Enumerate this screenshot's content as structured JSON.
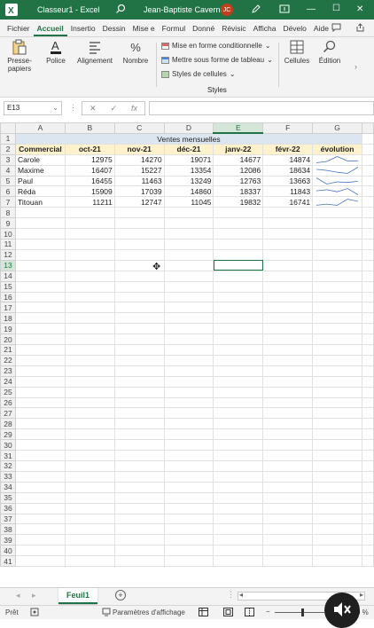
{
  "titlebar": {
    "filename": "Classeur1 - Excel",
    "user": "Jean-Baptiste Caverne",
    "initials": "JC",
    "minimize": "—",
    "maximize": "☐",
    "close": "✕"
  },
  "tabs": [
    "Fichier",
    "Accueil",
    "Insertio",
    "Dessin",
    "Mise e",
    "Formul",
    "Donné",
    "Révisic",
    "Afficha",
    "Dévelo",
    "Aide"
  ],
  "ribbon": {
    "paste_label": "Presse-\npapiers",
    "police_label": "Police",
    "alignment_label": "Alignement",
    "number_label": "Nombre",
    "conditional_label": "Mise en forme conditionnelle",
    "table_label": "Mettre sous forme de tableau",
    "cellstyles_label": "Styles de cellules",
    "styles_group_label": "Styles",
    "cells_label": "Cellules",
    "edition_label": "Édition"
  },
  "formula": {
    "namebox": "E13",
    "cancel": "✕",
    "confirm": "✓",
    "fx": "fx",
    "content": ""
  },
  "columns": [
    "A",
    "B",
    "C",
    "D",
    "E",
    "F",
    "G"
  ],
  "rows_count": 41,
  "selected_cell": "E13",
  "sheet": {
    "title": "Ventes mensuelles",
    "headers": [
      "Commercial",
      "oct-21",
      "nov-21",
      "déc-21",
      "janv-22",
      "févr-22",
      "évolution"
    ],
    "records": [
      {
        "name": "Carole",
        "values": [
          "12975",
          "14270",
          "19071",
          "14677",
          "14874"
        ]
      },
      {
        "name": "Maxime",
        "values": [
          "16407",
          "15227",
          "13354",
          "12086",
          "18634"
        ]
      },
      {
        "name": "Paul",
        "values": [
          "16455",
          "11463",
          "13249",
          "12763",
          "13663"
        ]
      },
      {
        "name": "Réda",
        "values": [
          "15909",
          "17039",
          "14860",
          "18337",
          "11843"
        ]
      },
      {
        "name": "Titouan",
        "values": [
          "11211",
          "12747",
          "11045",
          "19832",
          "16741"
        ]
      }
    ]
  },
  "sheettabs": {
    "active": "Feuil1",
    "add": "+"
  },
  "status": {
    "ready": "Prêt",
    "display_settings": "Paramètres d'affichage",
    "zoom_pct": "0 %"
  },
  "colors": {
    "accent": "#217346",
    "header_fill": "#fff2cc",
    "title_fill": "#dce6f1"
  }
}
